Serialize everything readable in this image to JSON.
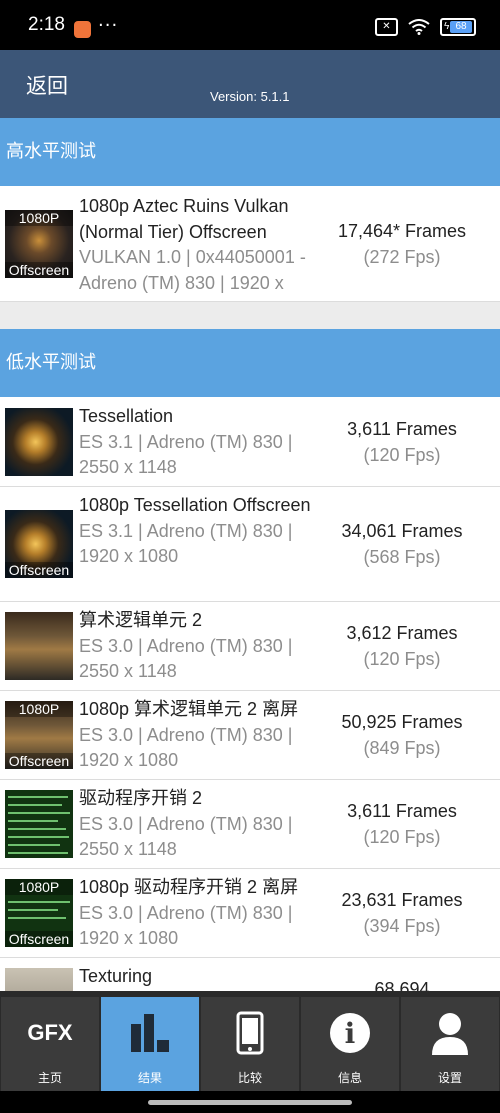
{
  "status": {
    "time": "2:18",
    "dots": "···",
    "battery": "68"
  },
  "appbar": {
    "back": "返回",
    "version": "Version: 5.1.1"
  },
  "sections": {
    "high": "高水平测试",
    "low": "低水平测试"
  },
  "high_tests": [
    {
      "thumb_top": "1080P",
      "thumb_bottom": "Offscreen",
      "title": "1080p Aztec Ruins Vulkan (Normal Tier) Offscreen",
      "sub": "VULKAN 1.0 | 0x44050001 - Adreno (TM) 830 | 1920 x",
      "frames": "17,464* Frames",
      "fps": "(272 Fps)"
    }
  ],
  "low_tests": [
    {
      "thumb_top": "",
      "thumb_bottom": "",
      "title": "Tessellation",
      "sub": "ES 3.1 | Adreno (TM) 830 | 2550 x 1148",
      "frames": "3,611 Frames",
      "fps": "(120 Fps)"
    },
    {
      "thumb_top": "",
      "thumb_bottom": "Offscreen",
      "title": "1080p Tessellation Offscreen",
      "sub": "ES 3.1 | Adreno (TM) 830 | 1920 x 1080",
      "frames": "34,061 Frames",
      "fps": "(568 Fps)"
    },
    {
      "thumb_top": "",
      "thumb_bottom": "",
      "title": "算术逻辑单元 2",
      "sub": "ES 3.0 | Adreno (TM) 830 | 2550 x 1148",
      "frames": "3,612 Frames",
      "fps": "(120 Fps)"
    },
    {
      "thumb_top": "1080P",
      "thumb_bottom": "Offscreen",
      "title": "1080p 算术逻辑单元 2 离屏",
      "sub": "ES 3.0 | Adreno (TM) 830 | 1920 x 1080",
      "frames": "50,925 Frames",
      "fps": "(849 Fps)"
    },
    {
      "thumb_top": "",
      "thumb_bottom": "",
      "title": "驱动程序开销 2",
      "sub": "ES 3.0 | Adreno (TM) 830 | 2550 x 1148",
      "frames": "3,611 Frames",
      "fps": "(120 Fps)"
    },
    {
      "thumb_top": "1080P",
      "thumb_bottom": "Offscreen",
      "title": "1080p 驱动程序开销 2 离屏",
      "sub": "ES 3.0 | Adreno (TM) 830 | 1920 x 1080",
      "frames": "23,631 Frames",
      "fps": "(394 Fps)"
    },
    {
      "thumb_top": "",
      "thumb_bottom": "",
      "title": "Texturing",
      "sub": "",
      "frames": "68,694",
      "fps": ""
    }
  ],
  "nav": [
    {
      "label": "主页",
      "icon": "gfx-logo",
      "text": "GFX"
    },
    {
      "label": "结果",
      "icon": "bar-chart-icon"
    },
    {
      "label": "比较",
      "icon": "phone-icon"
    },
    {
      "label": "信息",
      "icon": "info-icon",
      "text": "i"
    },
    {
      "label": "设置",
      "icon": "user-icon"
    }
  ]
}
